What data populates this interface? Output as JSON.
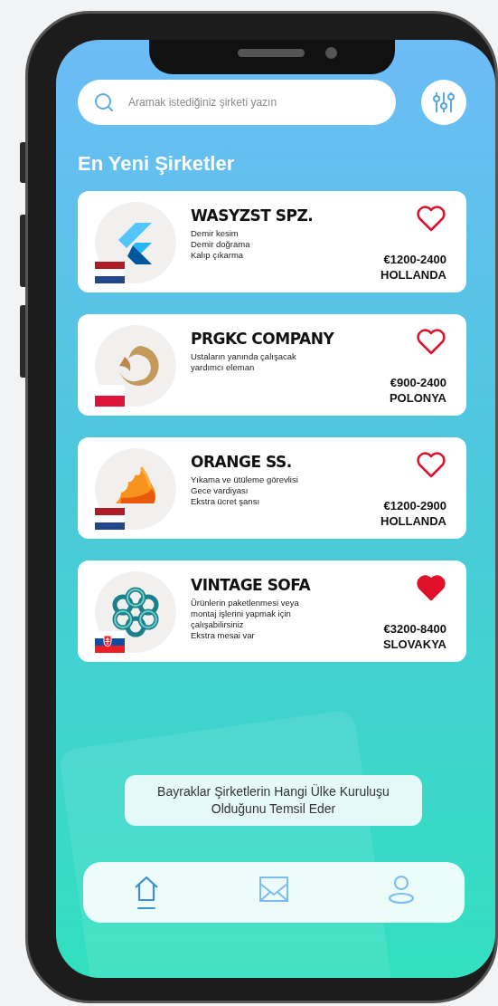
{
  "search": {
    "placeholder": "Aramak istediğiniz şirketi yazın"
  },
  "heading": "En Yeni Şirketler",
  "companies": [
    {
      "name": "WASYZST SPZ.",
      "details": [
        "Demir kesim",
        "Demir doğrama",
        "Kalıp çıkarma"
      ],
      "salary": "€1200-2400",
      "country": "HOLLANDA",
      "favorite": false,
      "logo": {
        "kind": "chevrons"
      },
      "flag": {
        "emblem": false,
        "stripes": [
          {
            "color": "#ae1c28"
          },
          {
            "color": "#ffffff"
          },
          {
            "color": "#21468b"
          }
        ]
      }
    },
    {
      "name": "PRGKC COMPANY",
      "details": [
        "Ustaların yanında çalışacak yardımcı eleman"
      ],
      "salary": "€900-2400",
      "country": "POLONYA",
      "favorite": false,
      "logo": {
        "kind": "lion"
      },
      "flag": {
        "emblem": false,
        "stripes": [
          {
            "color": "#ffffff"
          },
          {
            "color": "#dc143c"
          }
        ]
      }
    },
    {
      "name": "ORANGE SS.",
      "details": [
        "Yıkama ve ütüleme görevlisi",
        "Gece vardiyası",
        "Ekstra ücret şansı"
      ],
      "salary": "€1200-2900",
      "country": "HOLLANDA",
      "favorite": false,
      "logo": {
        "kind": "wings"
      },
      "flag": {
        "emblem": false,
        "stripes": [
          {
            "color": "#ae1c28"
          },
          {
            "color": "#ffffff"
          },
          {
            "color": "#21468b"
          }
        ]
      }
    },
    {
      "name": "VINTAGE SOFA",
      "details": [
        "Ürünlerin paketlenmesi veya montaj işlerini yapmak için çalışabilirsiniz",
        "Ekstra mesai var"
      ],
      "salary": "€3200-8400",
      "country": "SLOVAKYA",
      "favorite": true,
      "logo": {
        "kind": "knot"
      },
      "flag": {
        "emblem": true,
        "stripes": [
          {
            "color": "#ffffff"
          },
          {
            "color": "#0b4ea2"
          },
          {
            "color": "#ee1c25"
          }
        ]
      }
    }
  ],
  "hint": "Bayraklar Şirketlerin Hangi Ülke Kuruluşu Olduğunu Temsil Eder",
  "nav": [
    {
      "kind": "home",
      "selected": true
    },
    {
      "kind": "mail",
      "selected": false
    },
    {
      "kind": "user",
      "selected": false
    }
  ]
}
